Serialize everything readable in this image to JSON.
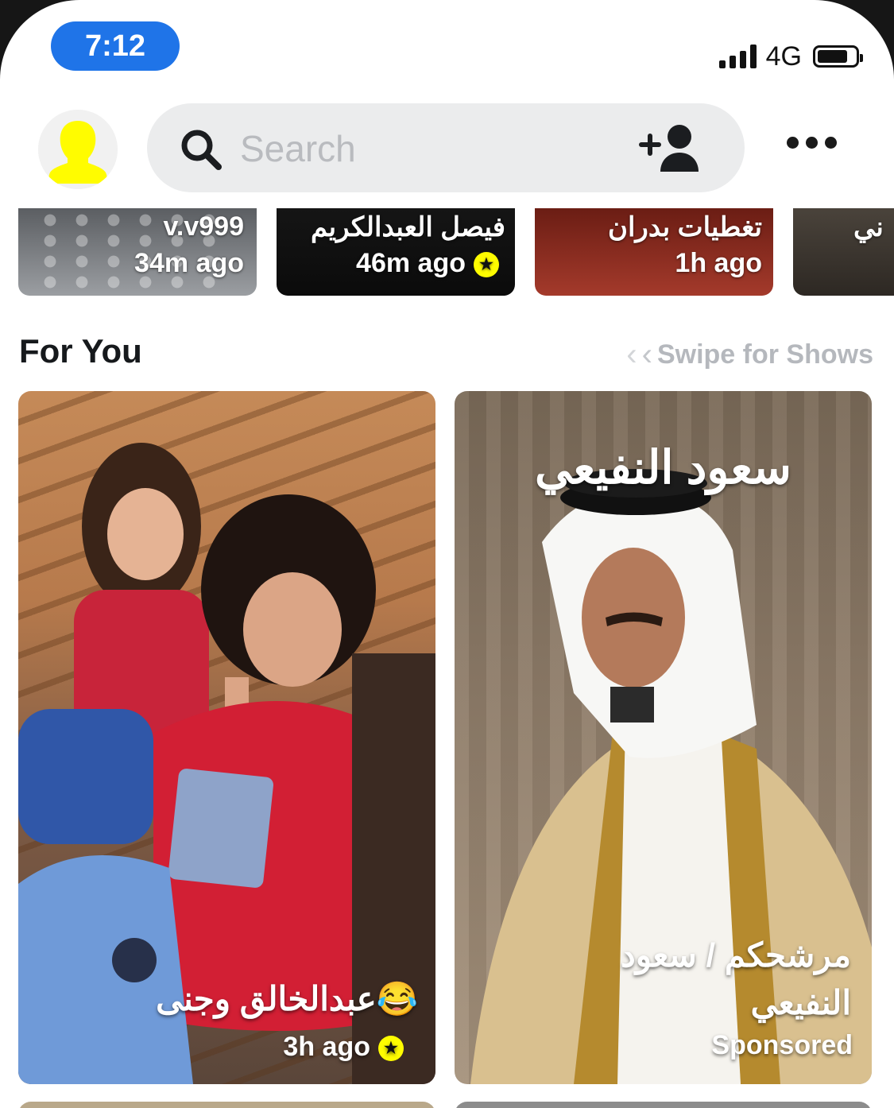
{
  "status_bar": {
    "time": "7:12",
    "network": "4G",
    "battery_level": 0.8
  },
  "header": {
    "search_placeholder": "Search",
    "icons": [
      "avatar-icon",
      "search-icon",
      "add-friend-icon",
      "more-icon"
    ]
  },
  "stories": [
    {
      "title": "v.v999",
      "age": "34m ago",
      "verified": false
    },
    {
      "title": "فيصل العبدالكريم",
      "age": "46m ago",
      "verified": true
    },
    {
      "title": "تغطيات بدران",
      "age": "1h ago",
      "verified": false
    },
    {
      "title": "ني",
      "age": "",
      "verified": false
    }
  ],
  "section": {
    "title": "For You",
    "swipe_hint": "Swipe for Shows"
  },
  "cards": [
    {
      "caption": "عبدالخالق وجنى😂",
      "age": "3h ago",
      "verified": true
    },
    {
      "overlay_title": "سعود النفيعي",
      "caption": "مرشحكم / سعود النفيعي",
      "label": "Sponsored"
    }
  ],
  "colors": {
    "accent": "#1f74e8",
    "snap_yellow": "#fffc00",
    "muted": "#b5b8bd"
  }
}
